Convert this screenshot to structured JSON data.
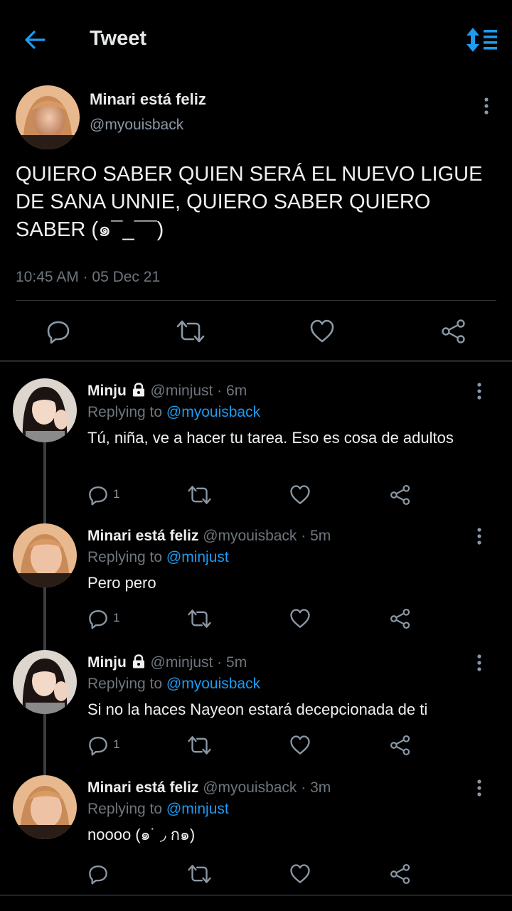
{
  "header": {
    "title": "Tweet"
  },
  "main_tweet": {
    "name": "Minari está feliz",
    "handle": "@myouisback",
    "text": "QUIERO SABER QUIEN SERÁ EL NUEVO LIGUE DE SANA UNNIE, QUIERO SABER QUIERO SABER (๑¯_¯¯)",
    "time": "10:45 AM · 05 Dec 21"
  },
  "replies": [
    {
      "name": "Minju",
      "handle": "@minjust · 6m",
      "replying_label": "Replying to",
      "replying_to": "@myouisback",
      "text": "Tú, niña, ve a hacer tu tarea. Eso es cosa de adultos",
      "reply_count": "1"
    },
    {
      "name": "Minari está feliz",
      "handle": "@myouisback · 5m",
      "replying_label": "Replying to",
      "replying_to": "@minjust",
      "text": "Pero pero",
      "reply_count": "1"
    },
    {
      "name": "Minju",
      "handle": "@minjust · 5m",
      "replying_label": "Replying to",
      "replying_to": "@myouisback",
      "text": "Si no la haces Nayeon estará decepcionada de ti",
      "reply_count": "1"
    },
    {
      "name": "Minari está feliz",
      "handle": "@myouisback · 3m",
      "replying_label": "Replying to",
      "replying_to": "@minjust",
      "text": "noooo (๑˙ ◞ ก๑)",
      "reply_count": ""
    }
  ],
  "colors": {
    "accent": "#1d9bf0",
    "background": "#000000",
    "muted": "#6e767d"
  },
  "icons": [
    "back-arrow-icon",
    "sort-icon",
    "more-vertical-icon",
    "reply-icon",
    "retweet-icon",
    "like-icon",
    "share-icon",
    "lock-icon"
  ]
}
